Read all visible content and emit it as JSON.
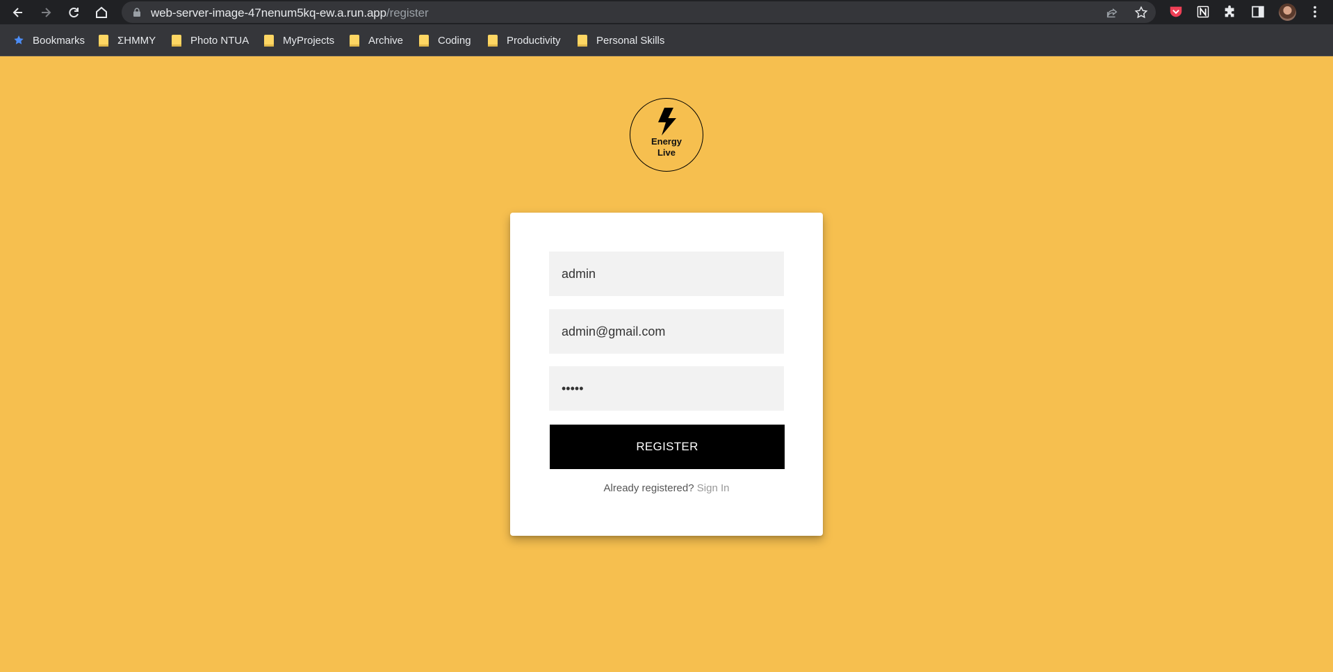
{
  "browser": {
    "url_host": "web-server-image-47nenum5kq-ew.a.run.app",
    "url_path": "/register",
    "bookmarks": [
      {
        "label": "Bookmarks",
        "icon": "star-icon"
      },
      {
        "label": "ΣΗΜΜΥ",
        "icon": "folder-icon"
      },
      {
        "label": "Photo NTUA",
        "icon": "folder-icon"
      },
      {
        "label": "MyProjects",
        "icon": "folder-icon"
      },
      {
        "label": "Archive",
        "icon": "folder-icon"
      },
      {
        "label": "Coding",
        "icon": "folder-icon"
      },
      {
        "label": "Productivity",
        "icon": "folder-icon"
      },
      {
        "label": "Personal Skills",
        "icon": "folder-icon"
      }
    ]
  },
  "logo": {
    "line1": "Energy",
    "line2": "Live",
    "icon": "lightning-bolt-icon"
  },
  "form": {
    "username_value": "admin",
    "email_value": "admin@gmail.com",
    "password_value": "•••••",
    "submit_label": "REGISTER",
    "already_text": "Already registered?",
    "signin_label": "Sign In"
  },
  "colors": {
    "page_background": "#f6bf4f",
    "button_background": "#000000",
    "field_background": "#f2f2f2"
  }
}
